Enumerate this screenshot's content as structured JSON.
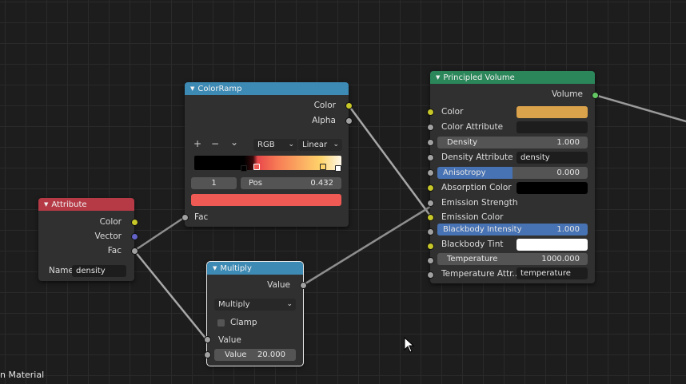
{
  "editor": {
    "footer_label": "n Material"
  },
  "colors": {
    "attribute_header": "#b53a46",
    "colorramp_header": "#3d8ab4",
    "multiply_header": "#3d8ab4",
    "volume_header": "#2b875a",
    "socket_color": "#c7c729",
    "socket_float": "#a1a1a1",
    "socket_vector": "#6363c7",
    "socket_shader": "#63c763",
    "selected_field": "#4772b3"
  },
  "attribute_node": {
    "title": "Attribute",
    "outputs": [
      "Color",
      "Vector",
      "Fac"
    ],
    "name_label": "Name",
    "name_value": "density"
  },
  "colorramp_node": {
    "title": "ColorRamp",
    "outputs": [
      "Color",
      "Alpha"
    ],
    "add_icon": "+",
    "remove_icon": "−",
    "menu_icon": "⌄",
    "color_mode": "RGB",
    "interpolation": "Linear",
    "stop_index": "1",
    "pos_label": "Pos",
    "pos_value": "0.432",
    "active_color": "#f05a55",
    "input_label": "Fac"
  },
  "multiply_node": {
    "title": "Multiply",
    "output_label": "Value",
    "operation": "Multiply",
    "clamp_label": "Clamp",
    "clamp_checked": false,
    "input1_label": "Value",
    "input2_label": "Value",
    "input2_value": "20.000"
  },
  "volume_node": {
    "title": "Principled Volume",
    "output_label": "Volume",
    "color_label": "Color",
    "color_swatch": "#daa24a",
    "color_attr_label": "Color Attribute",
    "color_attr_value": "",
    "density_label": "Density",
    "density_value": "1.000",
    "density_attr_label": "Density Attribute",
    "density_attr_value": "density",
    "anisotropy_label": "Anisotropy",
    "anisotropy_value": "0.000",
    "anisotropy_fill": 0.5,
    "absorption_label": "Absorption Color",
    "absorption_swatch": "#000000",
    "emission_strength_label": "Emission Strength",
    "emission_color_label": "Emission Color",
    "blackbody_label": "Blackbody Intensity",
    "blackbody_value": "1.000",
    "blackbody_fill": 1.0,
    "blackbody_tint_label": "Blackbody Tint",
    "blackbody_tint_swatch": "#ffffff",
    "temperature_label": "Temperature",
    "temperature_value": "1000.000",
    "temp_attr_label": "Temperature Attr...",
    "temp_attr_value": "temperature"
  }
}
